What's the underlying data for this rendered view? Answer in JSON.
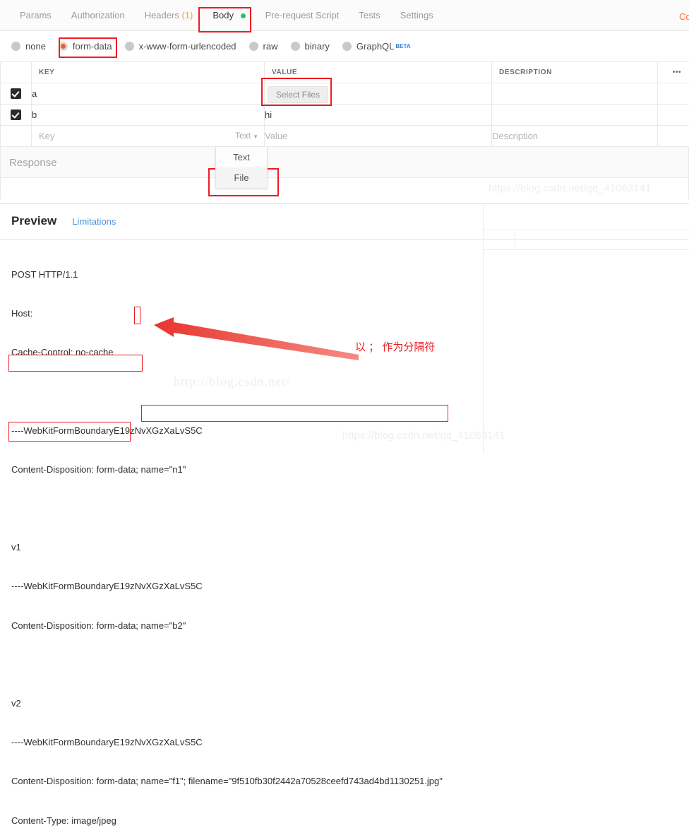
{
  "tabs": [
    {
      "label": "Params",
      "active": false,
      "badge": ""
    },
    {
      "label": "Authorization",
      "active": false,
      "badge": ""
    },
    {
      "label": "Headers",
      "active": false,
      "badge": "(1)"
    },
    {
      "label": "Body",
      "active": true,
      "badge": ""
    },
    {
      "label": "Pre-request Script",
      "active": false,
      "badge": ""
    },
    {
      "label": "Tests",
      "active": false,
      "badge": ""
    },
    {
      "label": "Settings",
      "active": false,
      "badge": ""
    }
  ],
  "cookies_edge_label": "Cookies",
  "body_types": [
    {
      "label": "none",
      "selected": false,
      "beta": ""
    },
    {
      "label": "form-data",
      "selected": true,
      "beta": ""
    },
    {
      "label": "x-www-form-urlencoded",
      "selected": false,
      "beta": ""
    },
    {
      "label": "raw",
      "selected": false,
      "beta": ""
    },
    {
      "label": "binary",
      "selected": false,
      "beta": ""
    },
    {
      "label": "GraphQL",
      "selected": false,
      "beta": "BETA"
    }
  ],
  "table": {
    "headers": {
      "key": "KEY",
      "value": "VALUE",
      "description": "DESCRIPTION",
      "more": "•••"
    },
    "rows": [
      {
        "checked": true,
        "key": "a",
        "value": "",
        "value_button": "Select Files",
        "description": ""
      },
      {
        "checked": true,
        "key": "b",
        "value": "hi",
        "value_button": "",
        "description": ""
      }
    ],
    "new_row": {
      "key_placeholder": "Key",
      "type_label": "Text",
      "value_placeholder": "Value",
      "description_placeholder": "Description"
    }
  },
  "response": {
    "label": "Response"
  },
  "dropdown": {
    "items": [
      {
        "label": "Text",
        "hovered": false
      },
      {
        "label": "File",
        "hovered": true
      }
    ]
  },
  "preview": {
    "title": "Preview",
    "limitations_link": "Limitations",
    "lines": [
      "POST HTTP/1.1",
      "Host:",
      "Cache-Control: no-cache",
      "",
      "----WebKitFormBoundaryE19zNvXGzXaLvS5C",
      "Content-Disposition: form-data; name=\"n1\"",
      "",
      "v1",
      "----WebKitFormBoundaryE19zNvXGzXaLvS5C",
      "Content-Disposition: form-data; name=\"b2\"",
      "",
      "v2",
      "----WebKitFormBoundaryE19zNvXGzXaLvS5C",
      "Content-Disposition: form-data; name=\"f1\"; filename=\"9f510fb30f2442a70528ceefd743ad4bd1130251.jpg\"",
      "Content-Type: image/jpeg"
    ]
  },
  "annotation": {
    "chinese_note": "以 ； 作为分隔符",
    "highlight_color": "#ee1c25"
  },
  "watermarks": {
    "top_right": "https://blog.csdn.net/qq_41063141",
    "middle_serif": "http://blog.csdn.net/",
    "bottom_right": "https://blog.csdn.net/qq_41063141"
  }
}
